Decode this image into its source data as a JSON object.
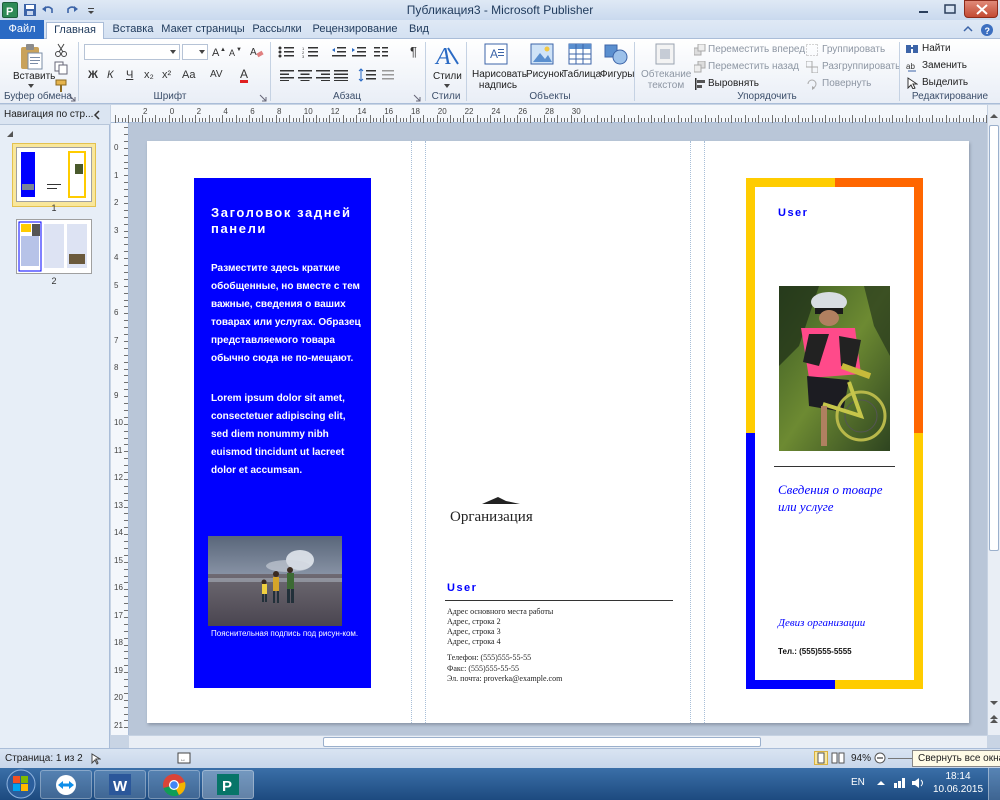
{
  "window": {
    "title": "Публикация3  -  Microsoft Publisher"
  },
  "tabs": [
    "Файл",
    "Главная",
    "Вставка",
    "Макет страницы",
    "Рассылки",
    "Рецензирование",
    "Вид"
  ],
  "ribbon": {
    "clipboard": {
      "paste": "Вставить",
      "group": "Буфер обмена"
    },
    "font": {
      "group": "Шрифт",
      "bold": "Ж",
      "italic": "К",
      "underline": "Ч",
      "small": "x₂",
      "super": "x²",
      "caps": "Aa",
      "spacing": "AV",
      "color": "A"
    },
    "paragraph": {
      "group": "Абзац",
      "pilcrow": "¶"
    },
    "styles": {
      "label": "Стили",
      "group": "Стили"
    },
    "objects": {
      "textbox": "Нарисовать надпись",
      "picture": "Рисунок",
      "table": "Таблица",
      "shapes": "Фигуры",
      "group": "Объекты"
    },
    "arrange": {
      "wrap": "Обтекание текстом",
      "forward": "Переместить вперед",
      "backward": "Переместить назад",
      "align": "Выровнять",
      "group_btn": "Группировать",
      "ungroup": "Разгруппировать",
      "rotate": "Повернуть",
      "group": "Упорядочить"
    },
    "editing": {
      "find": "Найти",
      "replace": "Заменить",
      "select": "Выделить",
      "group": "Редактирование"
    }
  },
  "nav": {
    "title": "Навигация по стр...",
    "pages": [
      "1",
      "2"
    ]
  },
  "ruler": {
    "h": [
      "2",
      "0",
      "2",
      "4",
      "6",
      "8",
      "10",
      "12",
      "14",
      "16",
      "18",
      "20",
      "22",
      "24",
      "26",
      "28",
      "30"
    ],
    "v": [
      "0",
      "1",
      "2",
      "3",
      "4",
      "5",
      "6",
      "7",
      "8",
      "9",
      "10",
      "11",
      "12",
      "13",
      "14",
      "15",
      "16",
      "17",
      "18",
      "19",
      "20",
      "21"
    ]
  },
  "panel_left": {
    "heading": "Заголовок задней панели",
    "body1": "Разместите здесь краткие обобщенные, но вместе с тем важные, сведения о ваших товарах или услугах. Образец представляемого товара обычно сюда не по-мещают.",
    "body2": "Lorem ipsum dolor sit amet, consectetuer adipiscing elit, sed diem nonummy nibh euismod tincidunt ut lacreet dolor et accumsan.",
    "caption": "Пояснительная подпись под рисун-ком."
  },
  "panel_middle": {
    "org": "Организация",
    "user": "User",
    "address": [
      "Адрес основного места работы",
      "Адрес, строка 2",
      "Адрес, строка 3",
      "Адрес, строка 4"
    ],
    "phone": "Телефон: (555)555-55-55",
    "fax": "Факс: (555)555-55-55",
    "email": "Эл. почта: proverka@example.com"
  },
  "panel_right": {
    "user": "User",
    "product": "Сведения о товаре или услуге",
    "motto": "Девиз организации",
    "tel": "Тел.: (555)555-5555"
  },
  "status": {
    "page": "Страница: 1 из 2",
    "zoom": "94%",
    "tooltip": "Свернуть все окна"
  },
  "taskbar": {
    "lang": "EN",
    "time": "18:14",
    "date": "10.06.2015"
  },
  "colors": {
    "blue": "#0000ff",
    "orange": "#ff6600",
    "yellow": "#ffcc00",
    "ribbon_blue": "#2a6ac4"
  }
}
